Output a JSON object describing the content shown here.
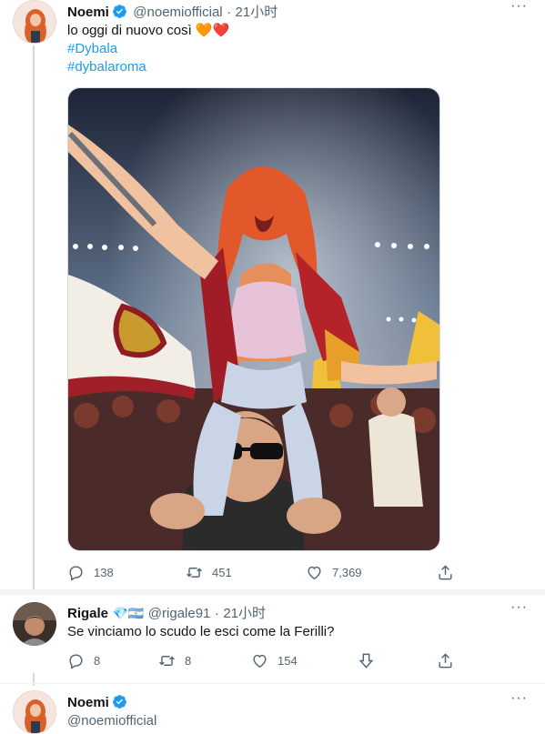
{
  "tweet1": {
    "name": "Noemi",
    "handle": "@noemiofficial",
    "separator": "·",
    "time": "21小时",
    "text": "lo oggi di nuovo così 🧡❤️",
    "hashtags": [
      "#Dybala",
      "#dybalaroma"
    ],
    "stats": {
      "reply": "138",
      "retweet": "451",
      "like": "7,369"
    }
  },
  "tweet2": {
    "name": "Rigale",
    "badges": "💎🇦🇷",
    "handle": "@rigale91",
    "separator": "·",
    "time": "21小时",
    "text": "Se vinciamo lo scudo le esci come la Ferilli?",
    "stats": {
      "reply": "8",
      "retweet": "8",
      "like": "154"
    }
  },
  "tweet3": {
    "name": "Noemi",
    "handle": "@noemiofficial"
  },
  "icons": {
    "more": "more-dots-icon",
    "reply": "reply-icon",
    "retweet": "retweet-icon",
    "like": "heart-icon",
    "share": "share-icon",
    "downvote": "downvote-icon",
    "verified": "verified-badge-icon"
  },
  "colors": {
    "accent": "#1d9bf0",
    "muted": "#536471",
    "text": "#0f1419"
  }
}
